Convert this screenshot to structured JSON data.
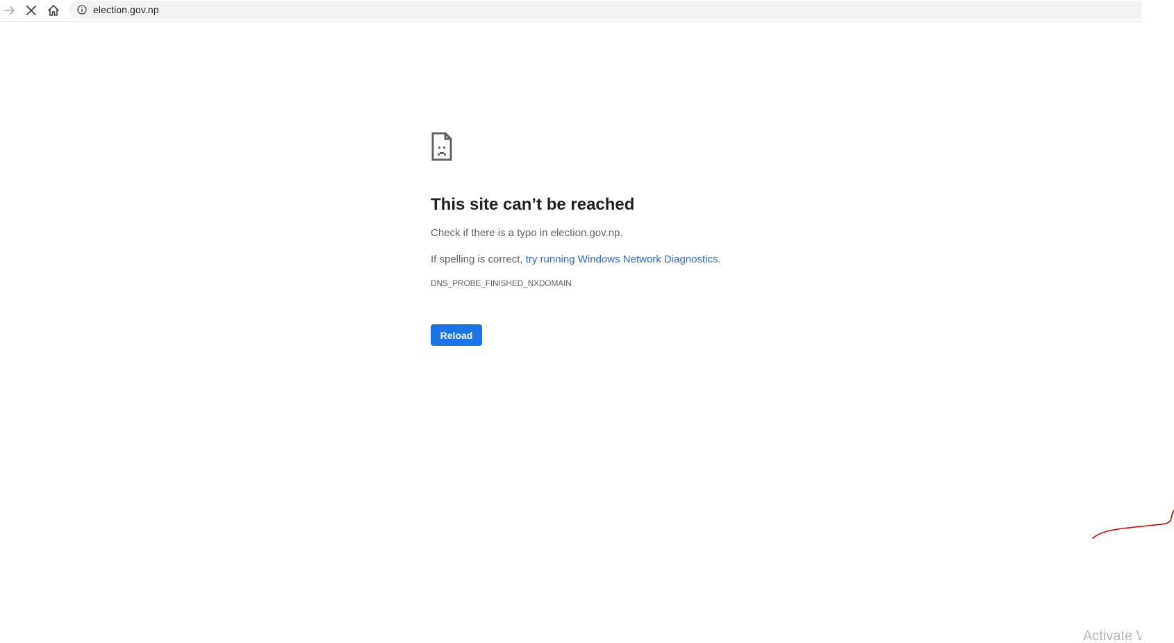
{
  "browser": {
    "url": "election.gov.np"
  },
  "error_page": {
    "title": "This site can’t be reached",
    "suggestion_typo": "Check if there is a typo in election.gov.np.",
    "suggestion_spelling_prefix": "If spelling is correct, ",
    "diagnostics_link": "try running Windows Network Diagnostics",
    "suggestion_spelling_suffix": ".",
    "error_code": "DNS_PROBE_FINISHED_NXDOMAIN",
    "reload_label": "Reload"
  },
  "watermark": {
    "text": "Activate Windows"
  },
  "colors": {
    "accent": "#1a73e8",
    "link": "#3367d6",
    "secondary_text": "#5f6368",
    "annotation": "#d40000"
  }
}
